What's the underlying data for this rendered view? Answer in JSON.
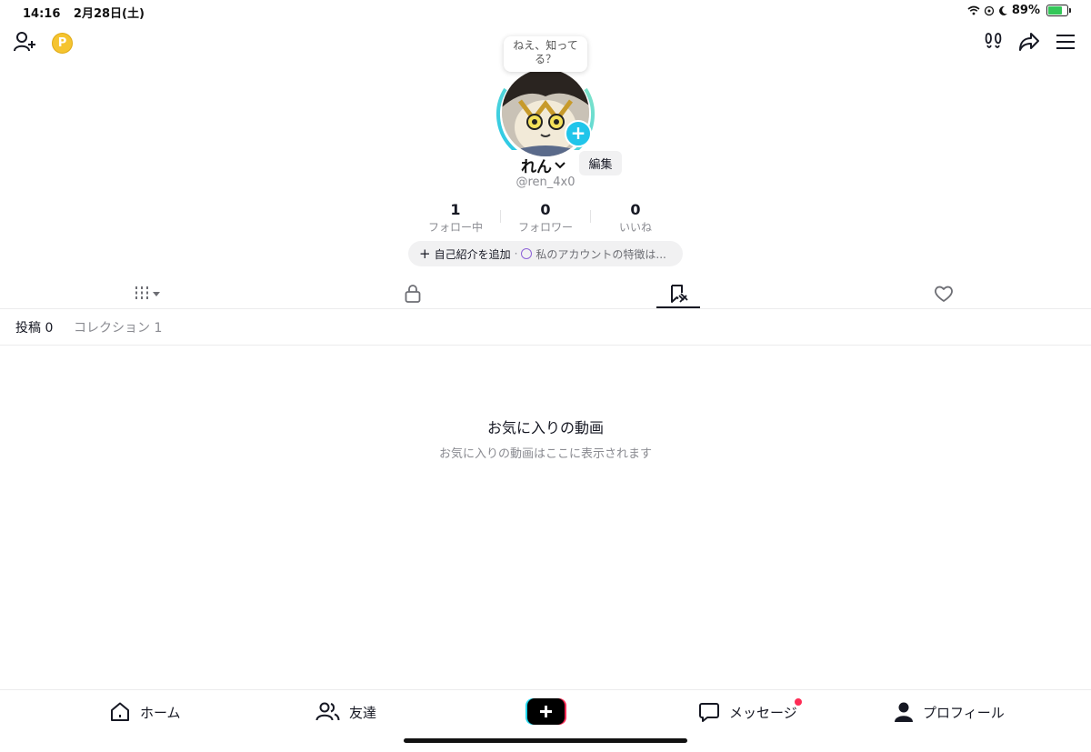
{
  "status_bar": {
    "time": "14:16",
    "date": "2月28日(土)",
    "battery": "89%"
  },
  "header": {
    "tooltip": "ねえ、知ってる？",
    "coin_symbol": "P"
  },
  "profile": {
    "name": "れん",
    "edit_label": "編集",
    "handle": "@ren_4x0",
    "stats": [
      {
        "value": "1",
        "label": "フォロー中"
      },
      {
        "value": "0",
        "label": "フォロワー"
      },
      {
        "value": "0",
        "label": "いいね"
      }
    ],
    "bio_add": "自己紹介を追加",
    "bio_separator": "·",
    "bio_feature": "私のアカウントの特徴は..."
  },
  "tabs": [
    {
      "icon": "grid-icon",
      "active": false
    },
    {
      "icon": "lock-icon",
      "active": false
    },
    {
      "icon": "favorites-icon",
      "active": true
    },
    {
      "icon": "heart-icon",
      "active": false
    }
  ],
  "subtabs": {
    "posts": "投稿 0",
    "collections": "コレクション 1"
  },
  "empty_state": {
    "title": "お気に入りの動画",
    "subtitle": "お気に入りの動画はここに表示されます"
  },
  "bottom_nav": {
    "home": "ホーム",
    "friends": "友達",
    "messages": "メッセージ",
    "profile": "プロフィール"
  },
  "colors": {
    "accent_cyan": "#20c5ea",
    "accent_red": "#fe2c55",
    "text": "#161823",
    "muted": "#8a8b91"
  }
}
